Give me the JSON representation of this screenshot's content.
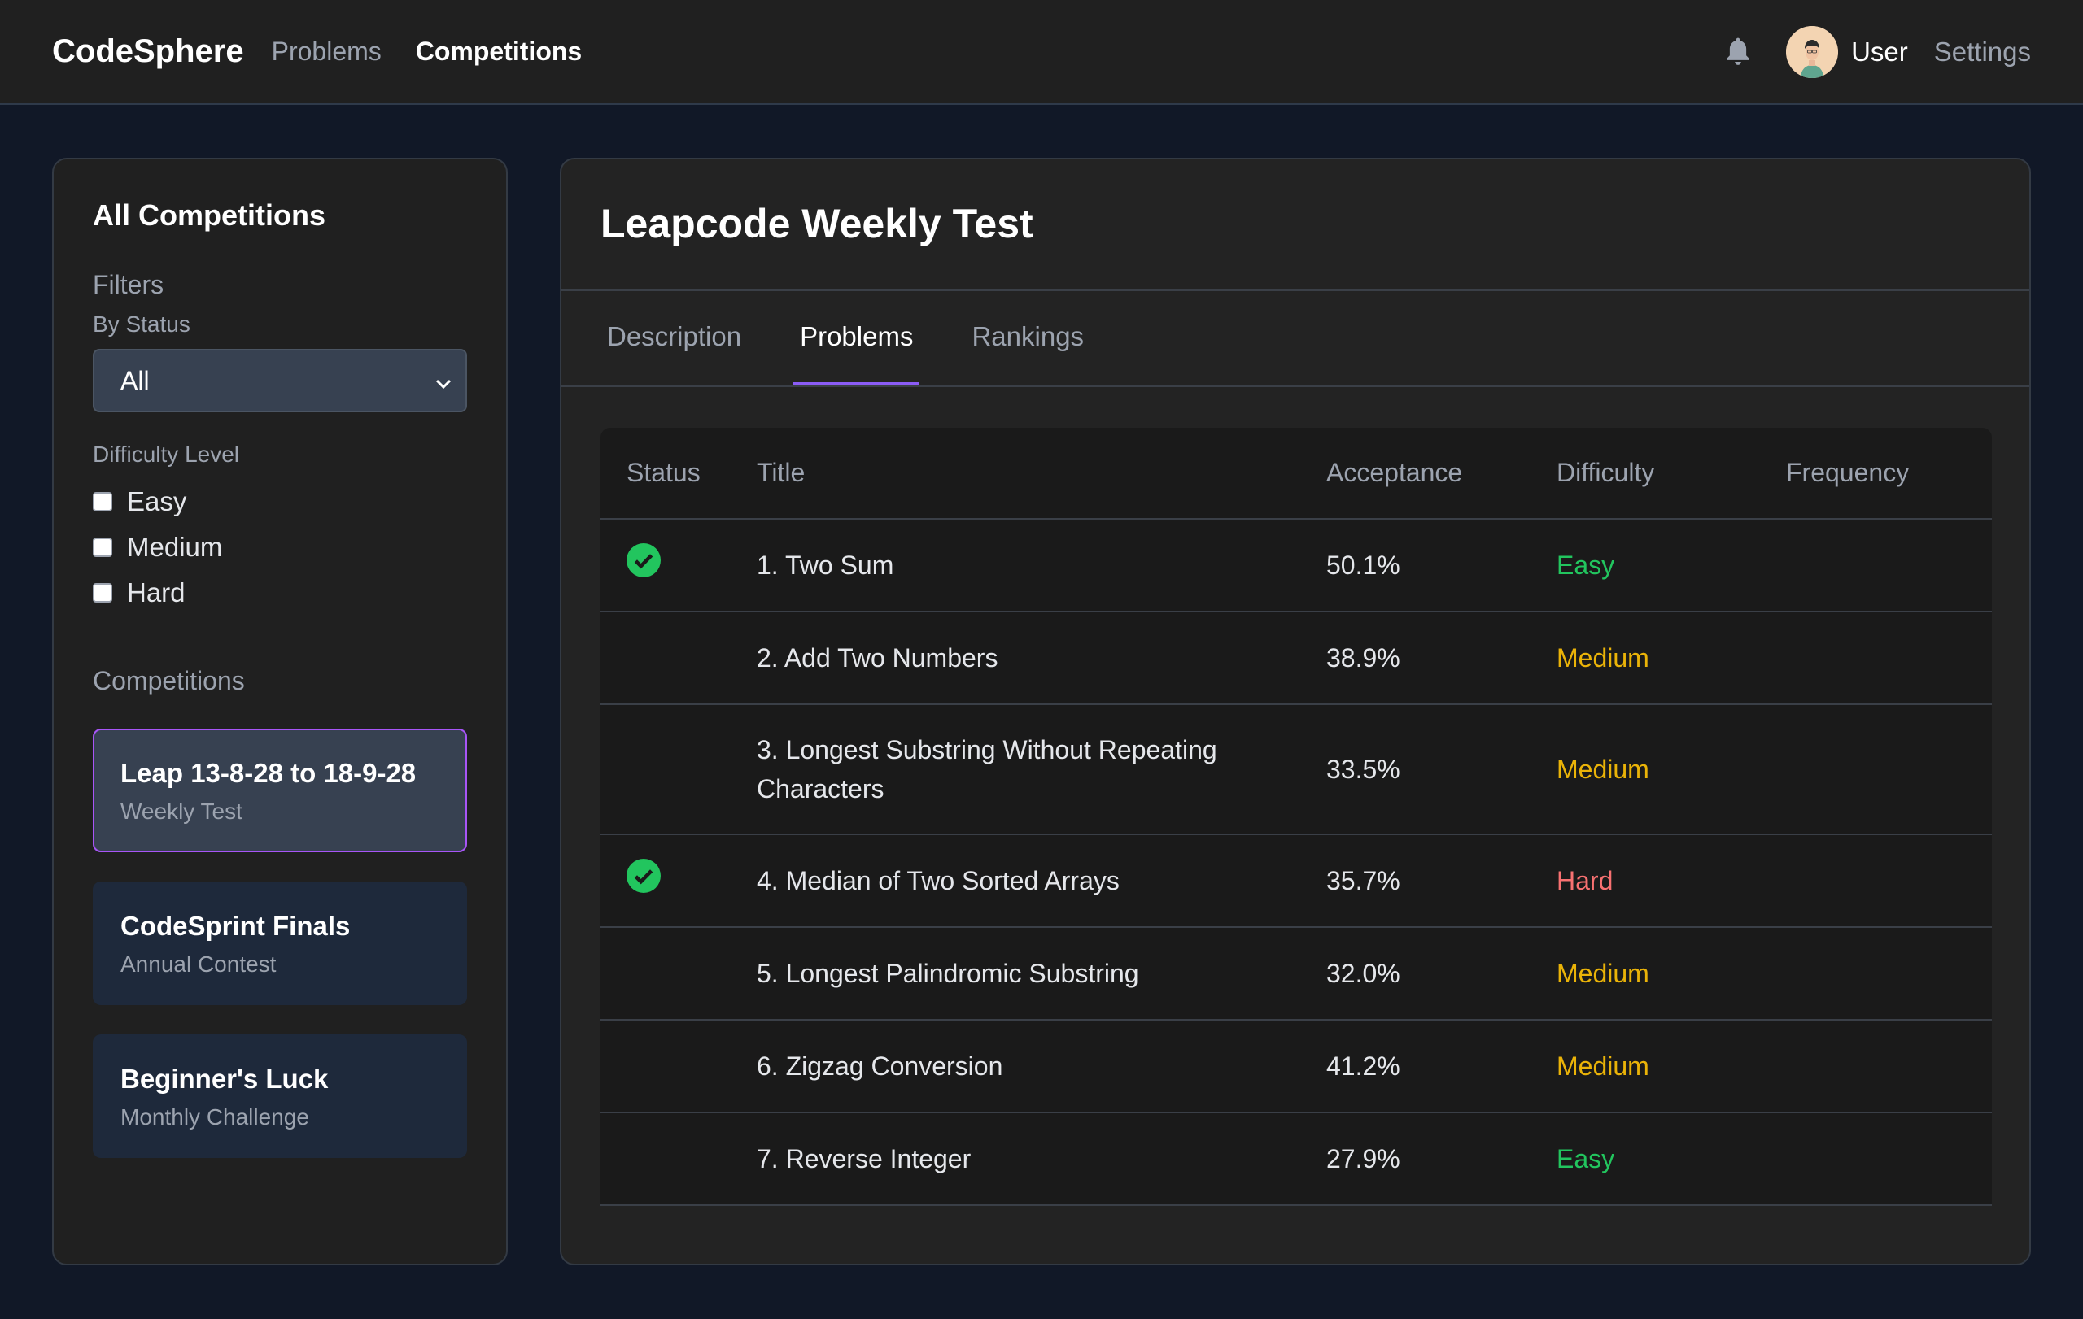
{
  "nav": {
    "brand": "CodeSphere",
    "links": [
      {
        "label": "Problems",
        "active": false
      },
      {
        "label": "Competitions",
        "active": true
      }
    ],
    "user_label": "User",
    "settings_label": "Settings",
    "icons": {
      "bell": "bell-icon",
      "avatar": "avatar-icon"
    }
  },
  "sidebar": {
    "title": "All Competitions",
    "filters_title": "Filters",
    "status_label": "By Status",
    "status_value": "All",
    "difficulty_label": "Difficulty Level",
    "difficulty_options": [
      "Easy",
      "Medium",
      "Hard"
    ],
    "competitions_title": "Competitions",
    "competitions": [
      {
        "name": "Leap 13-8-28 to 18-9-28",
        "sub": "Weekly Test",
        "active": true
      },
      {
        "name": "CodeSprint Finals",
        "sub": "Annual Contest",
        "active": false
      },
      {
        "name": "Beginner's Luck",
        "sub": "Monthly Challenge",
        "active": false
      }
    ]
  },
  "main": {
    "title": "Leapcode Weekly Test",
    "tabs": [
      {
        "label": "Description",
        "active": false
      },
      {
        "label": "Problems",
        "active": true
      },
      {
        "label": "Rankings",
        "active": false
      }
    ],
    "table": {
      "headers": [
        "Status",
        "Title",
        "Acceptance",
        "Difficulty",
        "Frequency"
      ],
      "rows": [
        {
          "solved": true,
          "title": "1. Two Sum",
          "acceptance": "50.1%",
          "difficulty": "Easy",
          "frequency": ""
        },
        {
          "solved": false,
          "title": "2. Add Two Numbers",
          "acceptance": "38.9%",
          "difficulty": "Medium",
          "frequency": ""
        },
        {
          "solved": false,
          "title": "3. Longest Substring Without Repeating Characters",
          "acceptance": "33.5%",
          "difficulty": "Medium",
          "frequency": ""
        },
        {
          "solved": true,
          "title": "4. Median of Two Sorted Arrays",
          "acceptance": "35.7%",
          "difficulty": "Hard",
          "frequency": ""
        },
        {
          "solved": false,
          "title": "5. Longest Palindromic Substring",
          "acceptance": "32.0%",
          "difficulty": "Medium",
          "frequency": ""
        },
        {
          "solved": false,
          "title": "6. Zigzag Conversion",
          "acceptance": "41.2%",
          "difficulty": "Medium",
          "frequency": ""
        },
        {
          "solved": false,
          "title": "7. Reverse Integer",
          "acceptance": "27.9%",
          "difficulty": "Easy",
          "frequency": ""
        }
      ]
    }
  },
  "colors": {
    "accent": "#8b5cf6",
    "solved": "#22c55e",
    "easy": "#22c55e",
    "medium": "#eab308",
    "hard": "#f87171"
  }
}
